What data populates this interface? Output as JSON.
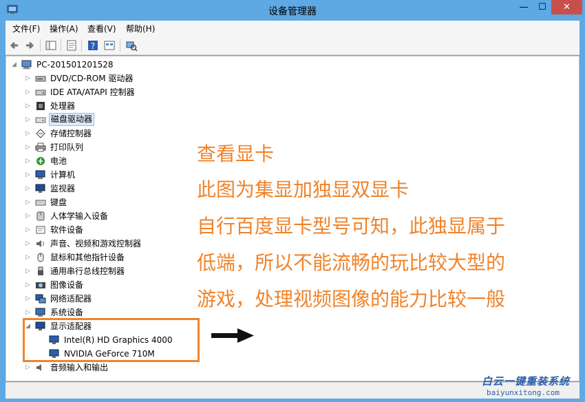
{
  "window": {
    "title": "设备管理器",
    "minimize_glyph": "—",
    "maximize_glyph": "☐",
    "close_glyph": "✕"
  },
  "menu": {
    "file": "文件(F)",
    "action": "操作(A)",
    "view": "查看(V)",
    "help": "帮助(H)"
  },
  "tree": {
    "root": "PC-201501201528",
    "categories": [
      "DVD/CD-ROM 驱动器",
      "IDE ATA/ATAPI 控制器",
      "处理器",
      "磁盘驱动器",
      "存储控制器",
      "打印队列",
      "电池",
      "计算机",
      "监视器",
      "键盘",
      "人体学输入设备",
      "软件设备",
      "声音、视频和游戏控制器",
      "鼠标和其他指针设备",
      "通用串行总线控制器",
      "图像设备",
      "网络适配器",
      "系统设备",
      "显示适配器"
    ],
    "display_children": [
      "Intel(R) HD Graphics 4000",
      "NVIDIA GeForce 710M"
    ],
    "last_category": "音频输入和输出",
    "selected_category": "磁盘驱动器"
  },
  "annotation": {
    "lines": [
      "查看显卡",
      "此图为集显加独显双显卡",
      "自行百度显卡型号可知，此独显属于",
      "低端，所以不能流畅的玩比较大型的",
      "游戏，处理视频图像的能力比较一般"
    ],
    "color": "#f0832a"
  },
  "watermark": {
    "brand": "白云一键重装系统",
    "url": "baiyunxitong.com"
  }
}
